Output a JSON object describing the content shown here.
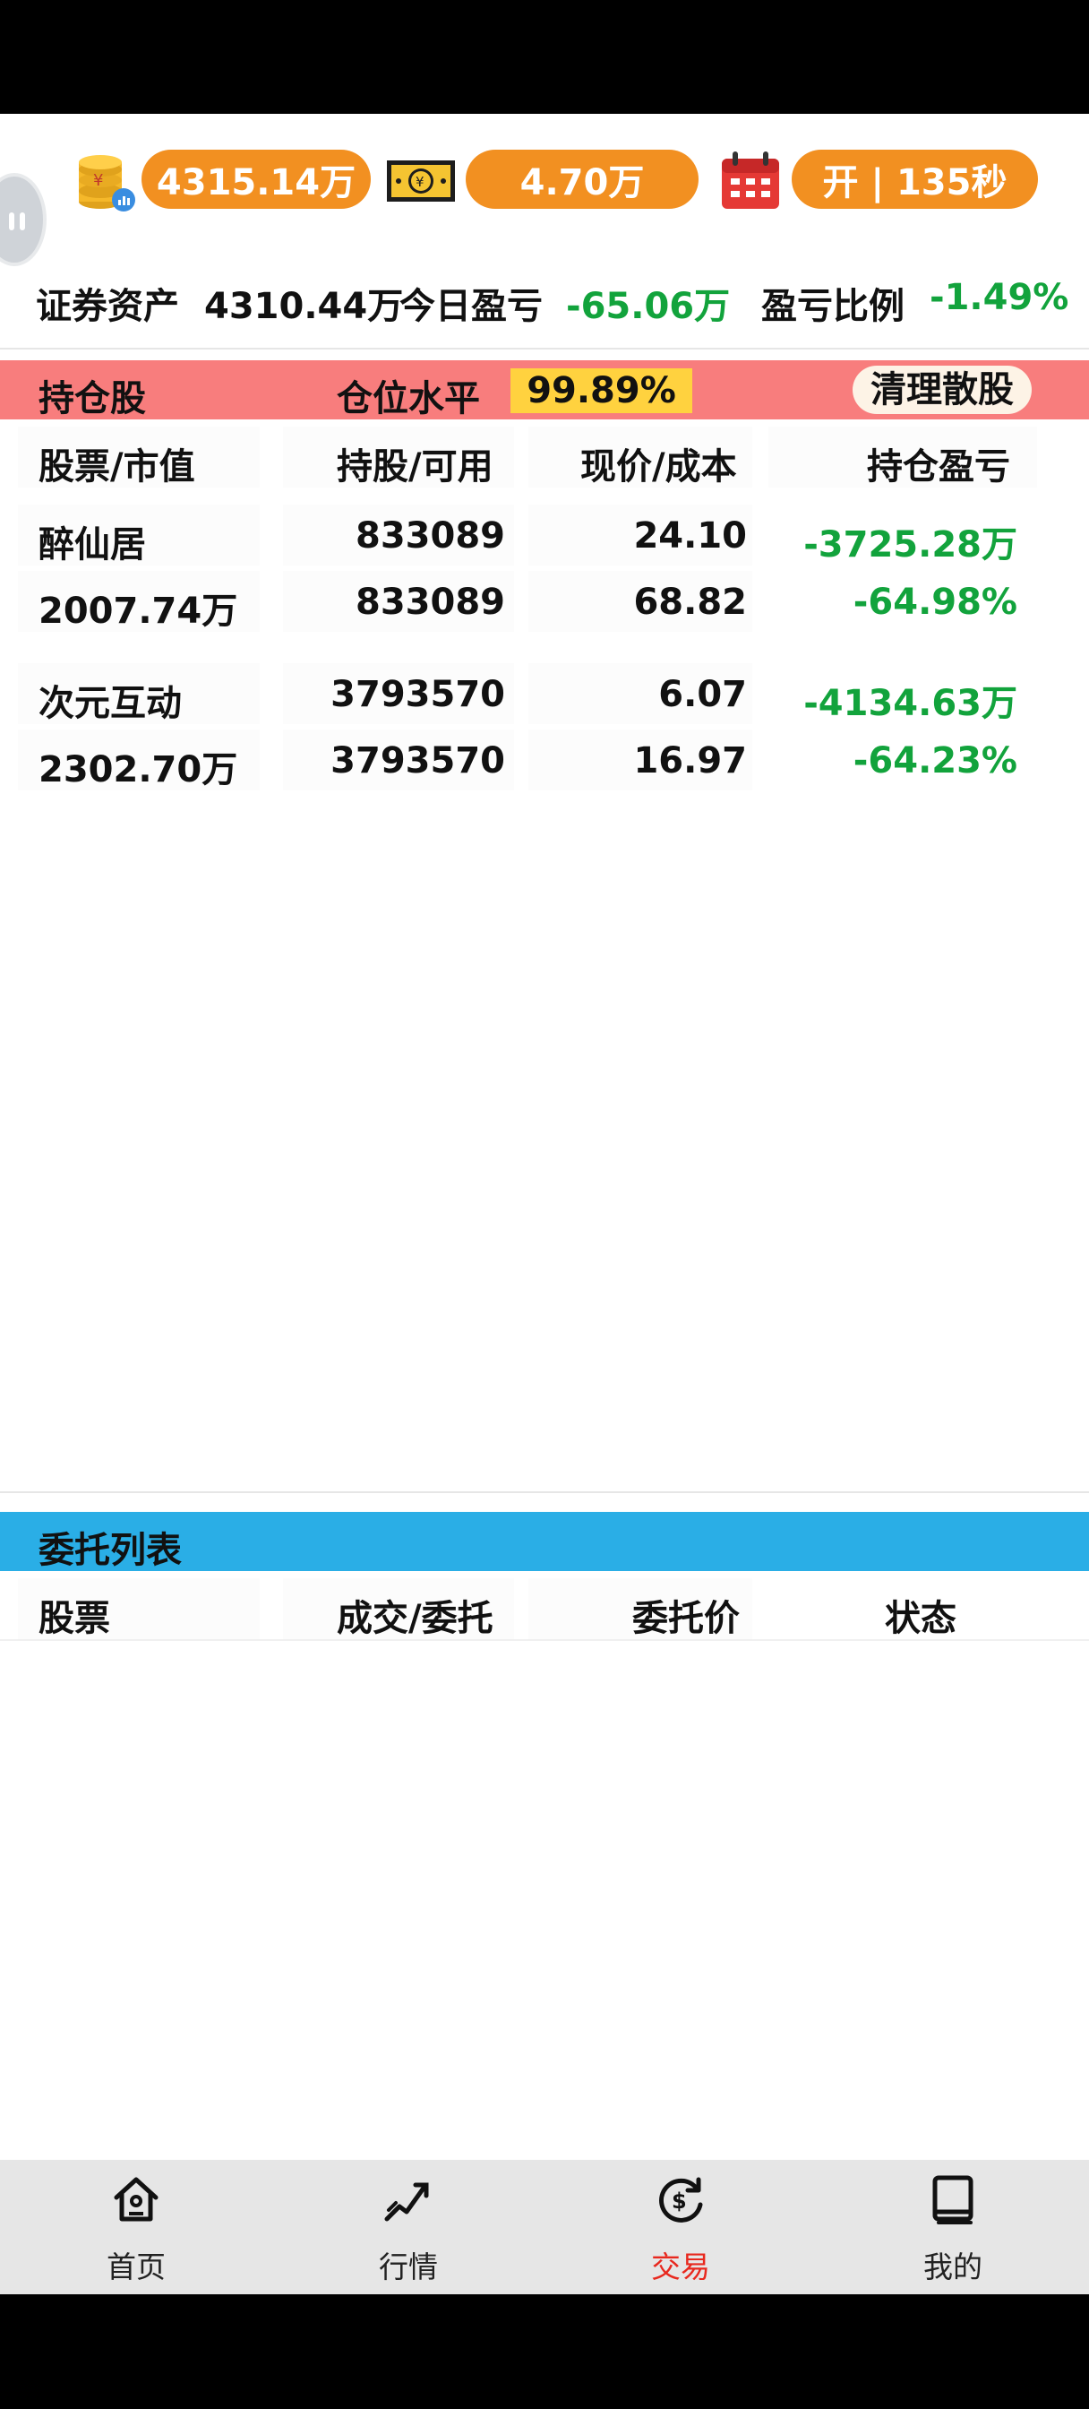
{
  "topbar": {
    "total_assets": "4315.14万",
    "cash": "4.70万",
    "market_status": "开 | 135秒"
  },
  "summary": {
    "assets_label": "证券资产",
    "assets_value": "4310.44万",
    "today_pl_label": "今日盈亏",
    "today_pl_value": "-65.06万",
    "pl_ratio_label": "盈亏比例",
    "pl_ratio_value": "-1.49%"
  },
  "holdings": {
    "title": "持仓股",
    "level_label": "仓位水平",
    "level_value": "99.89%",
    "clean_button": "清理散股",
    "columns": [
      "股票/市值",
      "持股/可用",
      "现价/成本",
      "持仓盈亏"
    ],
    "rows": [
      {
        "name": "醉仙居",
        "market_value": "2007.74万",
        "shares": "833089",
        "available": "833089",
        "price": "24.10",
        "cost": "68.82",
        "pl": "-3725.28万",
        "pl_pct": "-64.98%"
      },
      {
        "name": "次元互动",
        "market_value": "2302.70万",
        "shares": "3793570",
        "available": "3793570",
        "price": "6.07",
        "cost": "16.97",
        "pl": "-4134.63万",
        "pl_pct": "-64.23%"
      }
    ]
  },
  "orders": {
    "title": "委托列表",
    "columns": [
      "股票",
      "成交/委托",
      "委托价",
      "状态"
    ]
  },
  "nav": {
    "items": [
      {
        "label": "首页",
        "icon": "home-icon"
      },
      {
        "label": "行情",
        "icon": "trend-icon"
      },
      {
        "label": "交易",
        "icon": "trade-icon"
      },
      {
        "label": "我的",
        "icon": "book-icon"
      }
    ],
    "active_color": "#e8281e"
  },
  "colors": {
    "pill": "#f29021",
    "holdings_bar": "#f87d7d",
    "orders_bar": "#2aaee6",
    "loss_green": "#12a33c"
  }
}
